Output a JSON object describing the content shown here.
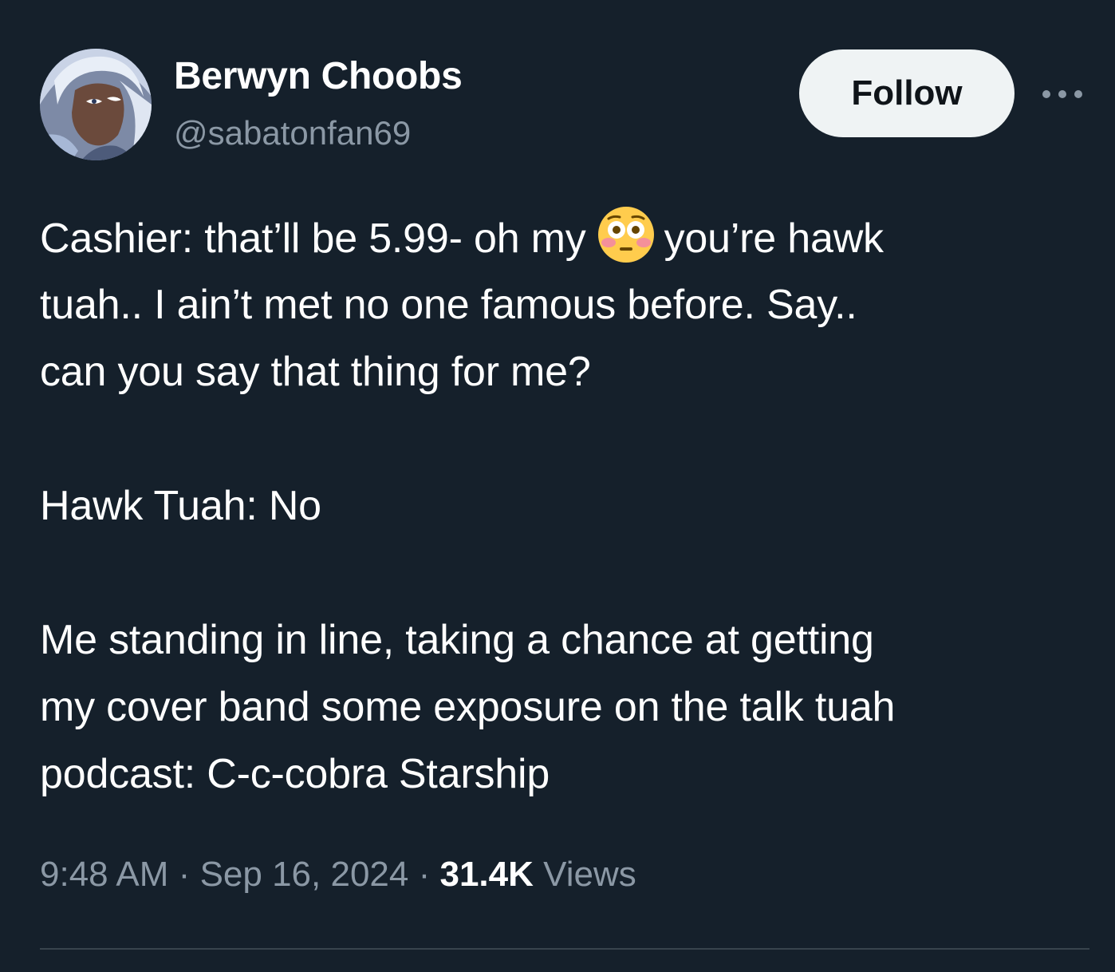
{
  "author": {
    "display_name": "Berwyn Choobs",
    "handle": "@sabatonfan69",
    "avatar_icon": "anime-character-avatar"
  },
  "actions": {
    "follow_label": "Follow",
    "more_icon": "more-horizontal-icon"
  },
  "tweet": {
    "line1_before_emoji": "Cashier: that’ll be 5.99- oh my",
    "emoji": "flushed-face-emoji",
    "line1_after_emoji": "you’re hawk",
    "line2": "tuah.. I ain’t met no one famous before. Say..",
    "line3": "can you say that thing for me?",
    "line4": "Hawk Tuah: No",
    "line5": "Me standing in line, taking a chance at getting",
    "line6": "my cover band some exposure on the talk tuah",
    "line7": "podcast: C-c-cobra Starship"
  },
  "meta": {
    "time": "9:48 AM",
    "separator": "·",
    "date": "Sep 16, 2024",
    "views_count": "31.4K",
    "views_label": "Views"
  },
  "colors": {
    "background": "#15202b",
    "secondary_text": "#8b98a5",
    "follow_button_bg": "#eff3f4",
    "divider": "#38444d"
  }
}
